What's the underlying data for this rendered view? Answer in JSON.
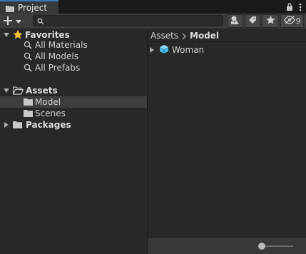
{
  "tab": {
    "title": "Project"
  },
  "toolbar": {
    "search": {
      "value": "",
      "placeholder": ""
    },
    "hidden_count": "9"
  },
  "tree": {
    "favorites": {
      "label": "Favorites",
      "items": [
        {
          "label": "All Materials"
        },
        {
          "label": "All Models"
        },
        {
          "label": "All Prefabs"
        }
      ]
    },
    "assets": {
      "label": "Assets",
      "children": [
        {
          "label": "Model",
          "selected": true
        },
        {
          "label": "Scenes",
          "selected": false
        }
      ]
    },
    "packages": {
      "label": "Packages"
    }
  },
  "breadcrumb": {
    "root": "Assets",
    "current": "Model"
  },
  "assets_list": [
    {
      "label": "Woman"
    }
  ],
  "zoom_slider": {
    "value": 0
  },
  "colors": {
    "accent": "#3a79bb",
    "star": "#f4c430",
    "prefab": "#4cb8e6",
    "selection": "#3e3e3e"
  }
}
